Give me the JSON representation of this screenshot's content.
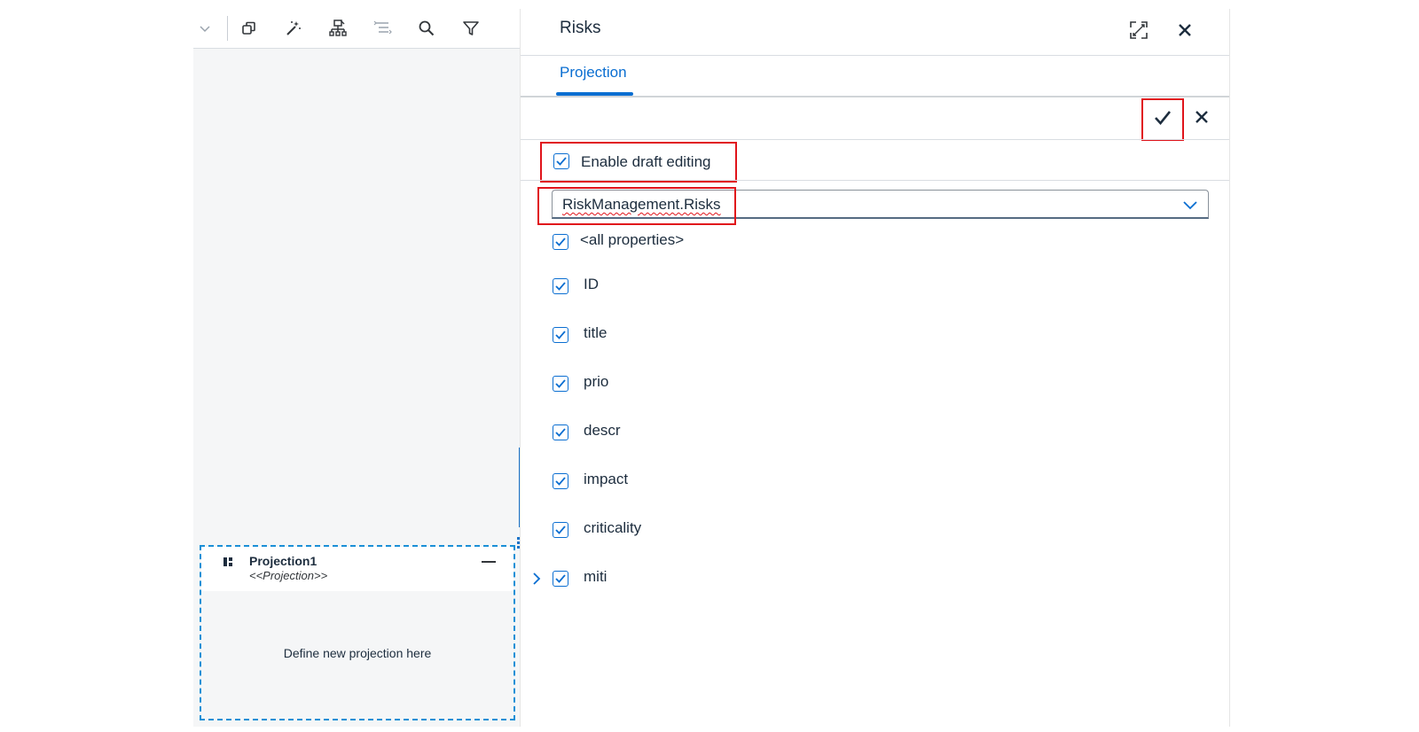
{
  "panel": {
    "title": "Risks",
    "tabs": [
      {
        "label": "Projection",
        "selected": true
      }
    ],
    "draft_editing": {
      "label": "Enable draft editing",
      "checked": true
    },
    "entity_select": {
      "value": "RiskManagement.Risks"
    },
    "properties": [
      {
        "label": "<all properties>",
        "checked": true
      },
      {
        "label": "ID",
        "checked": true
      },
      {
        "label": "title",
        "checked": true
      },
      {
        "label": "prio",
        "checked": true
      },
      {
        "label": "descr",
        "checked": true
      },
      {
        "label": "impact",
        "checked": true
      },
      {
        "label": "criticality",
        "checked": true
      },
      {
        "label": "miti",
        "checked": true,
        "expandable": true
      }
    ]
  },
  "canvas": {
    "projection": {
      "name": "Projection1",
      "stereotype": "<<Projection>>",
      "hint": "Define new projection here"
    }
  },
  "colors": {
    "accent": "#0a6ed1",
    "highlight": "#e0141b",
    "selection_border": "#1a8fd6",
    "canvas_bg": "#f5f6f7"
  },
  "icons": {
    "toolbar": [
      "chevron-down-icon",
      "copy-icon",
      "magic-wand-icon",
      "hierarchy-icon",
      "outline-icon",
      "search-icon",
      "filter-icon"
    ],
    "header": [
      "exit-full-screen-icon",
      "close-icon"
    ],
    "actions": [
      "checkmark-icon",
      "cancel-icon"
    ]
  }
}
